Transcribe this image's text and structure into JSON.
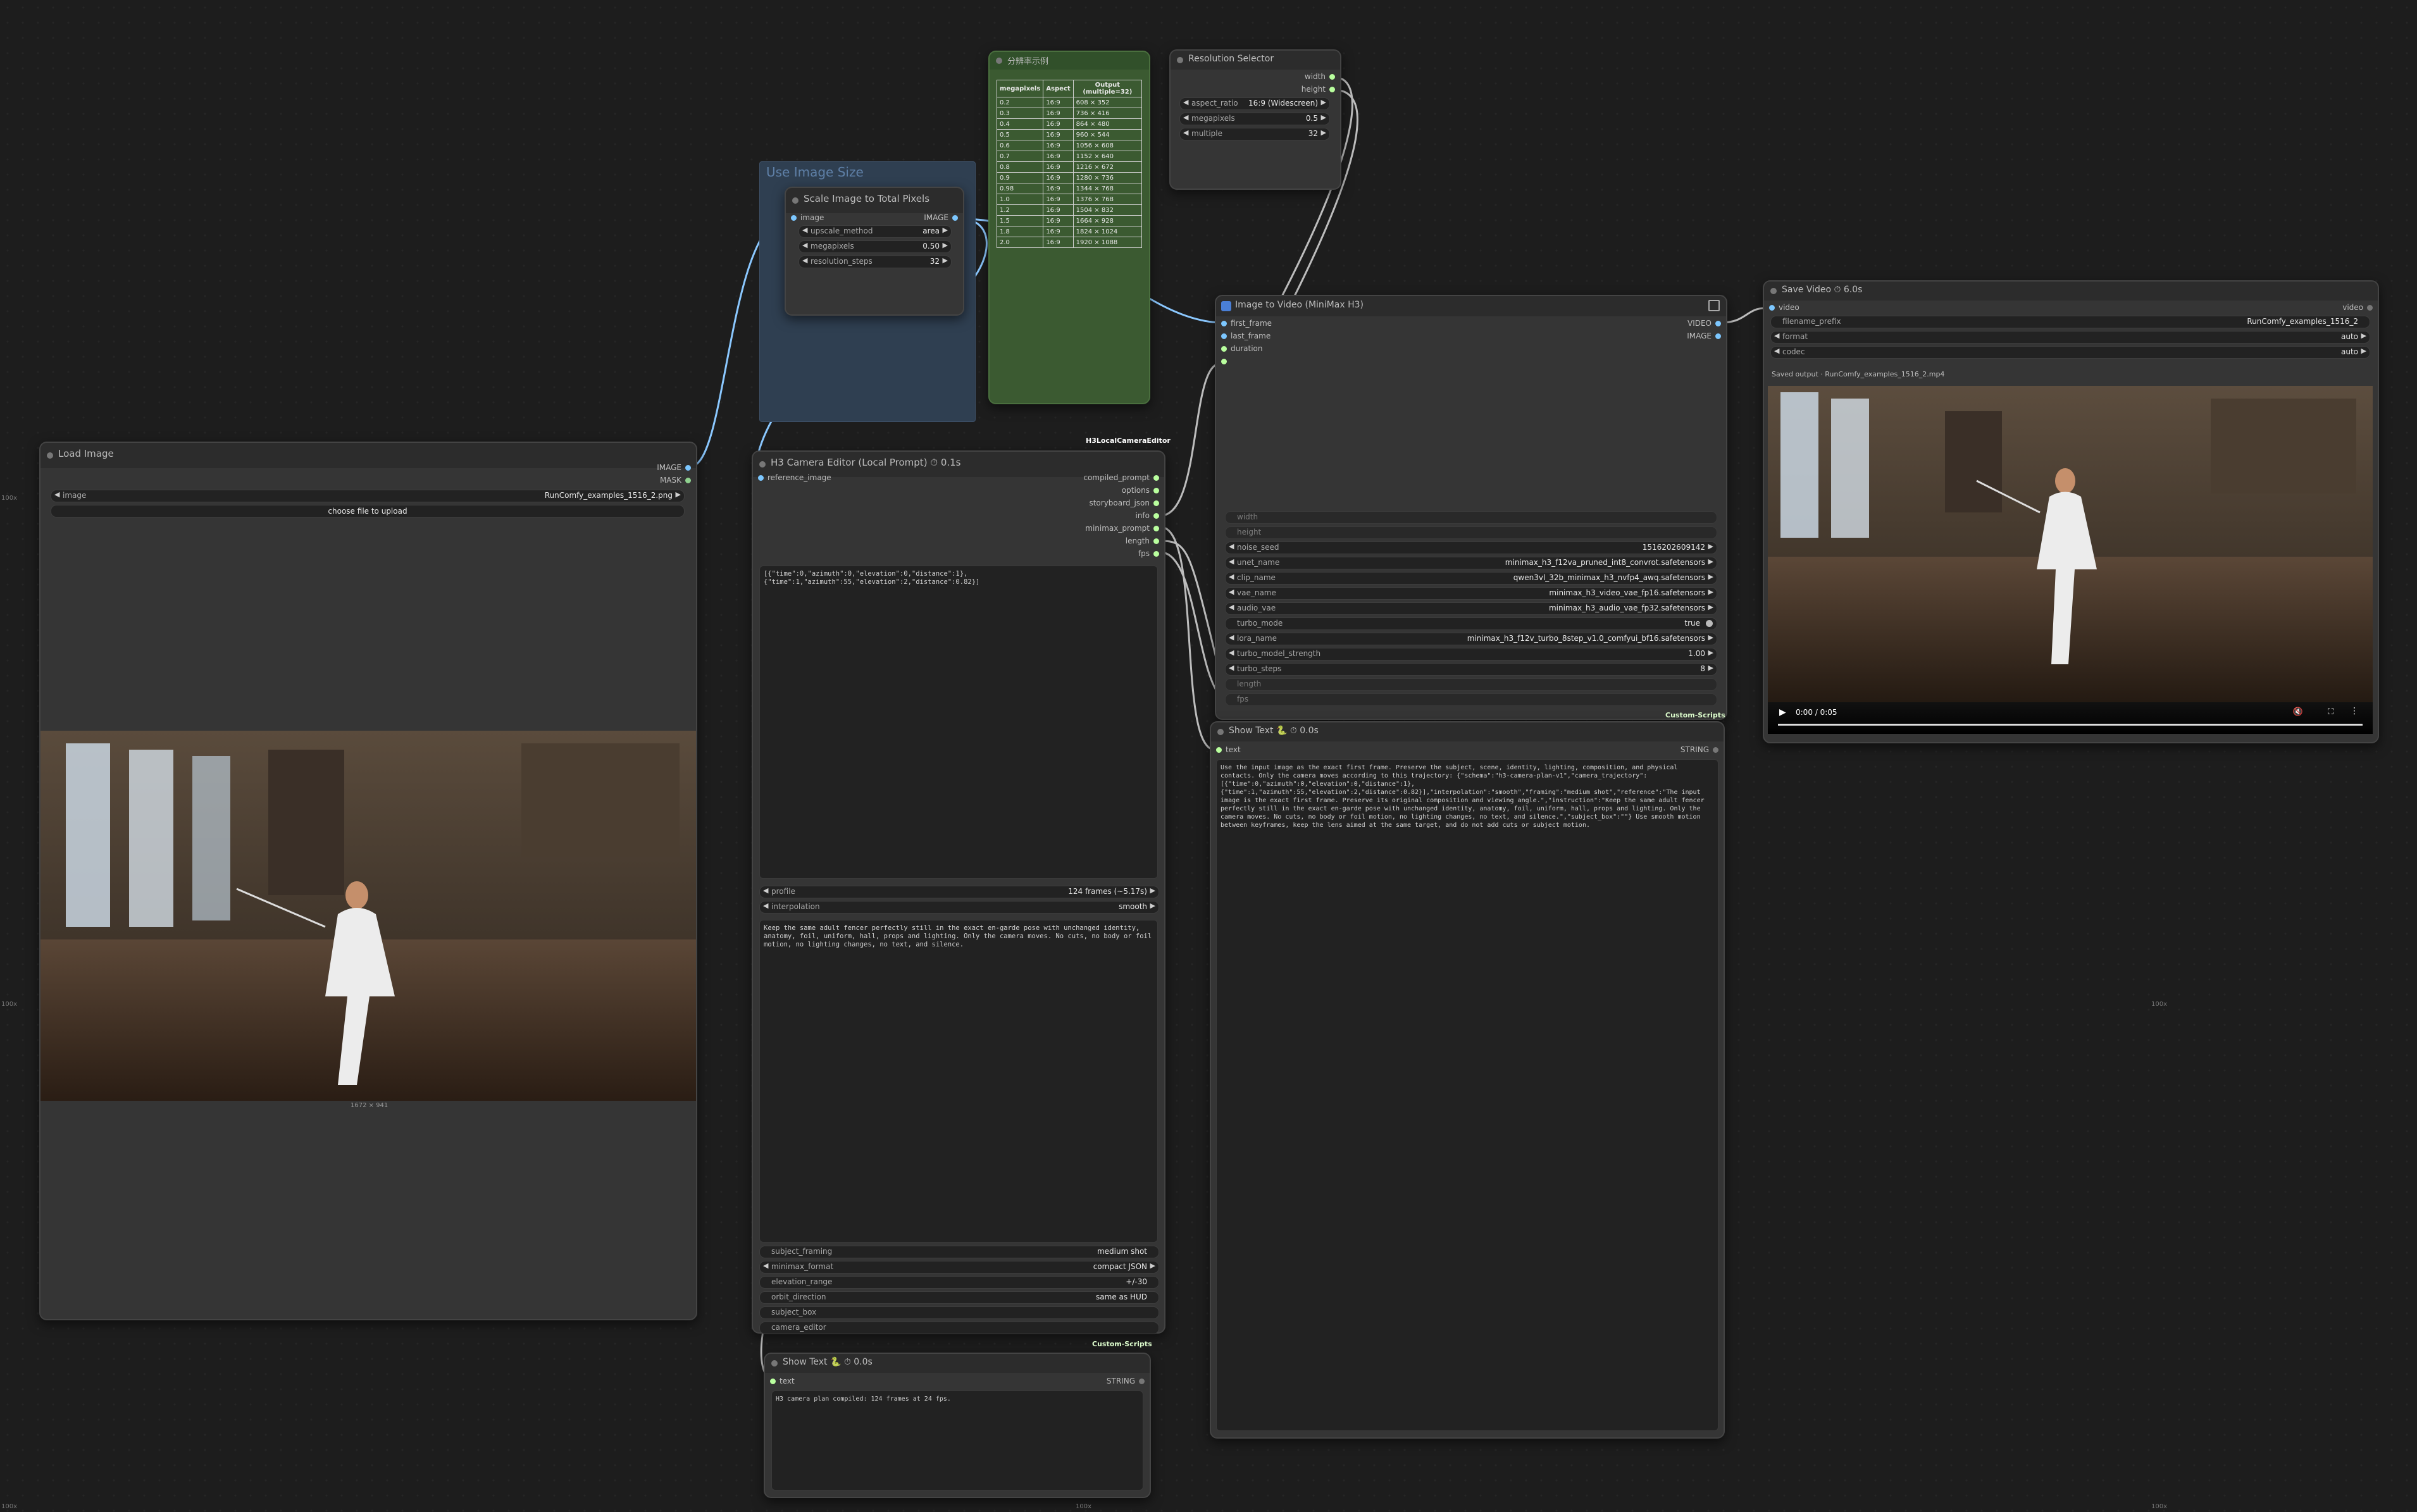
{
  "colors": {
    "canvas": "#1d1d1d",
    "node": "#353535",
    "group_blue": "#2f3f51",
    "group_green": "#3b5a31",
    "link": "#8bc8ff",
    "accent_green": "#b9ff9e"
  },
  "edge_labels": {
    "left_top": "100x",
    "left_mid": "100x",
    "right_mid": "100x",
    "bottom_left": "100x",
    "bottom_mid": "100x",
    "bottom_right": "100x"
  },
  "group_use_image_size": {
    "title": "Use Image Size"
  },
  "scale_node": {
    "title": "Scale Image to Total Pixels",
    "in_image": "image",
    "out_image": "IMAGE",
    "upscale_method": {
      "label": "upscale_method",
      "value": "area"
    },
    "megapixels": {
      "label": "megapixels",
      "value": "0.50"
    },
    "resolution_steps": {
      "label": "resolution_steps",
      "value": "32"
    }
  },
  "table_node": {
    "title": "分辨率示例",
    "headers": [
      "megapixels",
      "Aspect",
      "Output (multiple=32)"
    ],
    "rows": [
      [
        "0.2",
        "16:9",
        "608 × 352"
      ],
      [
        "0.3",
        "16:9",
        "736 × 416"
      ],
      [
        "0.4",
        "16:9",
        "864 × 480"
      ],
      [
        "0.5",
        "16:9",
        "960 × 544"
      ],
      [
        "0.6",
        "16:9",
        "1056 × 608"
      ],
      [
        "0.7",
        "16:9",
        "1152 × 640"
      ],
      [
        "0.8",
        "16:9",
        "1216 × 672"
      ],
      [
        "0.9",
        "16:9",
        "1280 × 736"
      ],
      [
        "0.98",
        "16:9",
        "1344 × 768"
      ],
      [
        "1.0",
        "16:9",
        "1376 × 768"
      ],
      [
        "1.2",
        "16:9",
        "1504 × 832"
      ],
      [
        "1.5",
        "16:9",
        "1664 × 928"
      ],
      [
        "1.8",
        "16:9",
        "1824 × 1024"
      ],
      [
        "2.0",
        "16:9",
        "1920 × 1088"
      ]
    ]
  },
  "resolution_selector": {
    "title": "Resolution Selector",
    "out_width": "width",
    "out_height": "height",
    "aspect_ratio": {
      "label": "aspect_ratio",
      "value": "16:9 (Widescreen)"
    },
    "megapixels": {
      "label": "megapixels",
      "value": "0.5"
    },
    "multiple": {
      "label": "multiple",
      "value": "32"
    }
  },
  "load_image": {
    "title": "Load Image",
    "out_image": "IMAGE",
    "out_mask": "MASK",
    "image": {
      "label": "image",
      "value": "RunComfy_examples_1516_2.png"
    },
    "upload": "choose file to upload",
    "dims": "1672 × 941"
  },
  "camera_editor": {
    "type_tag": "H3LocalCameraEditor",
    "title": "H3 Camera Editor (Local Prompt)",
    "time": "0.1s",
    "in_ref": "reference_image",
    "outputs": [
      "compiled_prompt",
      "options",
      "storyboard_json",
      "info",
      "minimax_prompt",
      "length",
      "fps"
    ],
    "keyframes": "[{\"time\":0,\"azimuth\":0,\"elevation\":0,\"distance\":1},\n{\"time\":1,\"azimuth\":55,\"elevation\":2,\"distance\":0.82}]",
    "profile": {
      "label": "profile",
      "value": "124 frames (~5.17s)"
    },
    "interpolation": {
      "label": "interpolation",
      "value": "smooth"
    },
    "instruction": "Keep the same adult fencer perfectly still in the exact en-garde pose with unchanged identity, anatomy, foil, uniform, hall, props and lighting. Only the camera moves. No cuts, no body or foil motion, no lighting changes, no text, and silence.",
    "subject_framing": {
      "label": "subject_framing",
      "value": "medium shot"
    },
    "minimax_format": {
      "label": "minimax_format",
      "value": "compact JSON"
    },
    "elevation_range": {
      "label": "elevation_range",
      "value": "+/-30"
    },
    "orbit_direction": {
      "label": "orbit_direction",
      "value": "same as HUD"
    },
    "subject_box": {
      "label": "subject_box",
      "value": ""
    },
    "camera_editor_w": {
      "label": "camera_editor",
      "value": ""
    },
    "footer_tag": "Custom-Scripts"
  },
  "show_text_small": {
    "title": "Show Text 🐍",
    "time": "0.0s",
    "in_text": "text",
    "out": "STRING",
    "content": "H3 camera plan compiled: 124 frames at 24 fps."
  },
  "i2v_node": {
    "title": "Image to Video (MiniMax H3)",
    "in_first": "first_frame",
    "in_last": "last_frame",
    "in_duration": "duration",
    "out_video": "VIDEO",
    "out_image": "IMAGE",
    "width": {
      "label": "width",
      "value": ""
    },
    "height": {
      "label": "height",
      "value": ""
    },
    "noise_seed": {
      "label": "noise_seed",
      "value": "1516202609142"
    },
    "unet_name": {
      "label": "unet_name",
      "value": "minimax_h3_f12va_pruned_int8_convrot.safetensors"
    },
    "clip_name": {
      "label": "clip_name",
      "value": "qwen3vl_32b_minimax_h3_nvfp4_awq.safetensors"
    },
    "vae_name": {
      "label": "vae_name",
      "value": "minimax_h3_video_vae_fp16.safetensors"
    },
    "audio_vae": {
      "label": "audio_vae",
      "value": "minimax_h3_audio_vae_fp32.safetensors"
    },
    "turbo_mode": {
      "label": "turbo_mode",
      "value": "true"
    },
    "lora_name": {
      "label": "lora_name",
      "value": "minimax_h3_f12v_turbo_8step_v1.0_comfyui_bf16.safetensors"
    },
    "turbo_model_strength": {
      "label": "turbo_model_strength",
      "value": "1.00"
    },
    "turbo_steps": {
      "label": "turbo_steps",
      "value": "8"
    },
    "length": {
      "label": "length",
      "value": ""
    },
    "fps": {
      "label": "fps",
      "value": ""
    },
    "footer_tag": "Custom-Scripts"
  },
  "show_text_big": {
    "title": "Show Text 🐍",
    "time": "0.0s",
    "in_text": "text",
    "out": "STRING",
    "content": "Use the input image as the exact first frame. Preserve the subject, scene, identity, lighting, composition, and physical contacts. Only the camera moves according to this trajectory: {\"schema\":\"h3-camera-plan-v1\",\"camera_trajectory\":[{\"time\":0,\"azimuth\":0,\"elevation\":0,\"distance\":1},{\"time\":1,\"azimuth\":55,\"elevation\":2,\"distance\":0.82}],\"interpolation\":\"smooth\",\"framing\":\"medium shot\",\"reference\":\"The input image is the exact first frame. Preserve its original composition and viewing angle.\",\"instruction\":\"Keep the same adult fencer perfectly still in the exact en-garde pose with unchanged identity, anatomy, foil, uniform, hall, props and lighting. Only the camera moves. No cuts, no body or foil motion, no lighting changes, no text, and silence.\",\"subject_box\":\"\"} Use smooth motion between keyframes, keep the lens aimed at the same target, and do not add cuts or subject motion."
  },
  "save_video": {
    "title": "Save Video",
    "time": "6.0s",
    "in_video": "video",
    "out_video": "video",
    "filename_prefix": {
      "label": "filename_prefix",
      "value": "RunComfy_examples_1516_2"
    },
    "format": {
      "label": "format",
      "value": "auto"
    },
    "codec": {
      "label": "codec",
      "value": "auto"
    },
    "saved": "Saved output · RunComfy_examples_1516_2.mp4",
    "player_time": "0:00 / 0:05"
  }
}
